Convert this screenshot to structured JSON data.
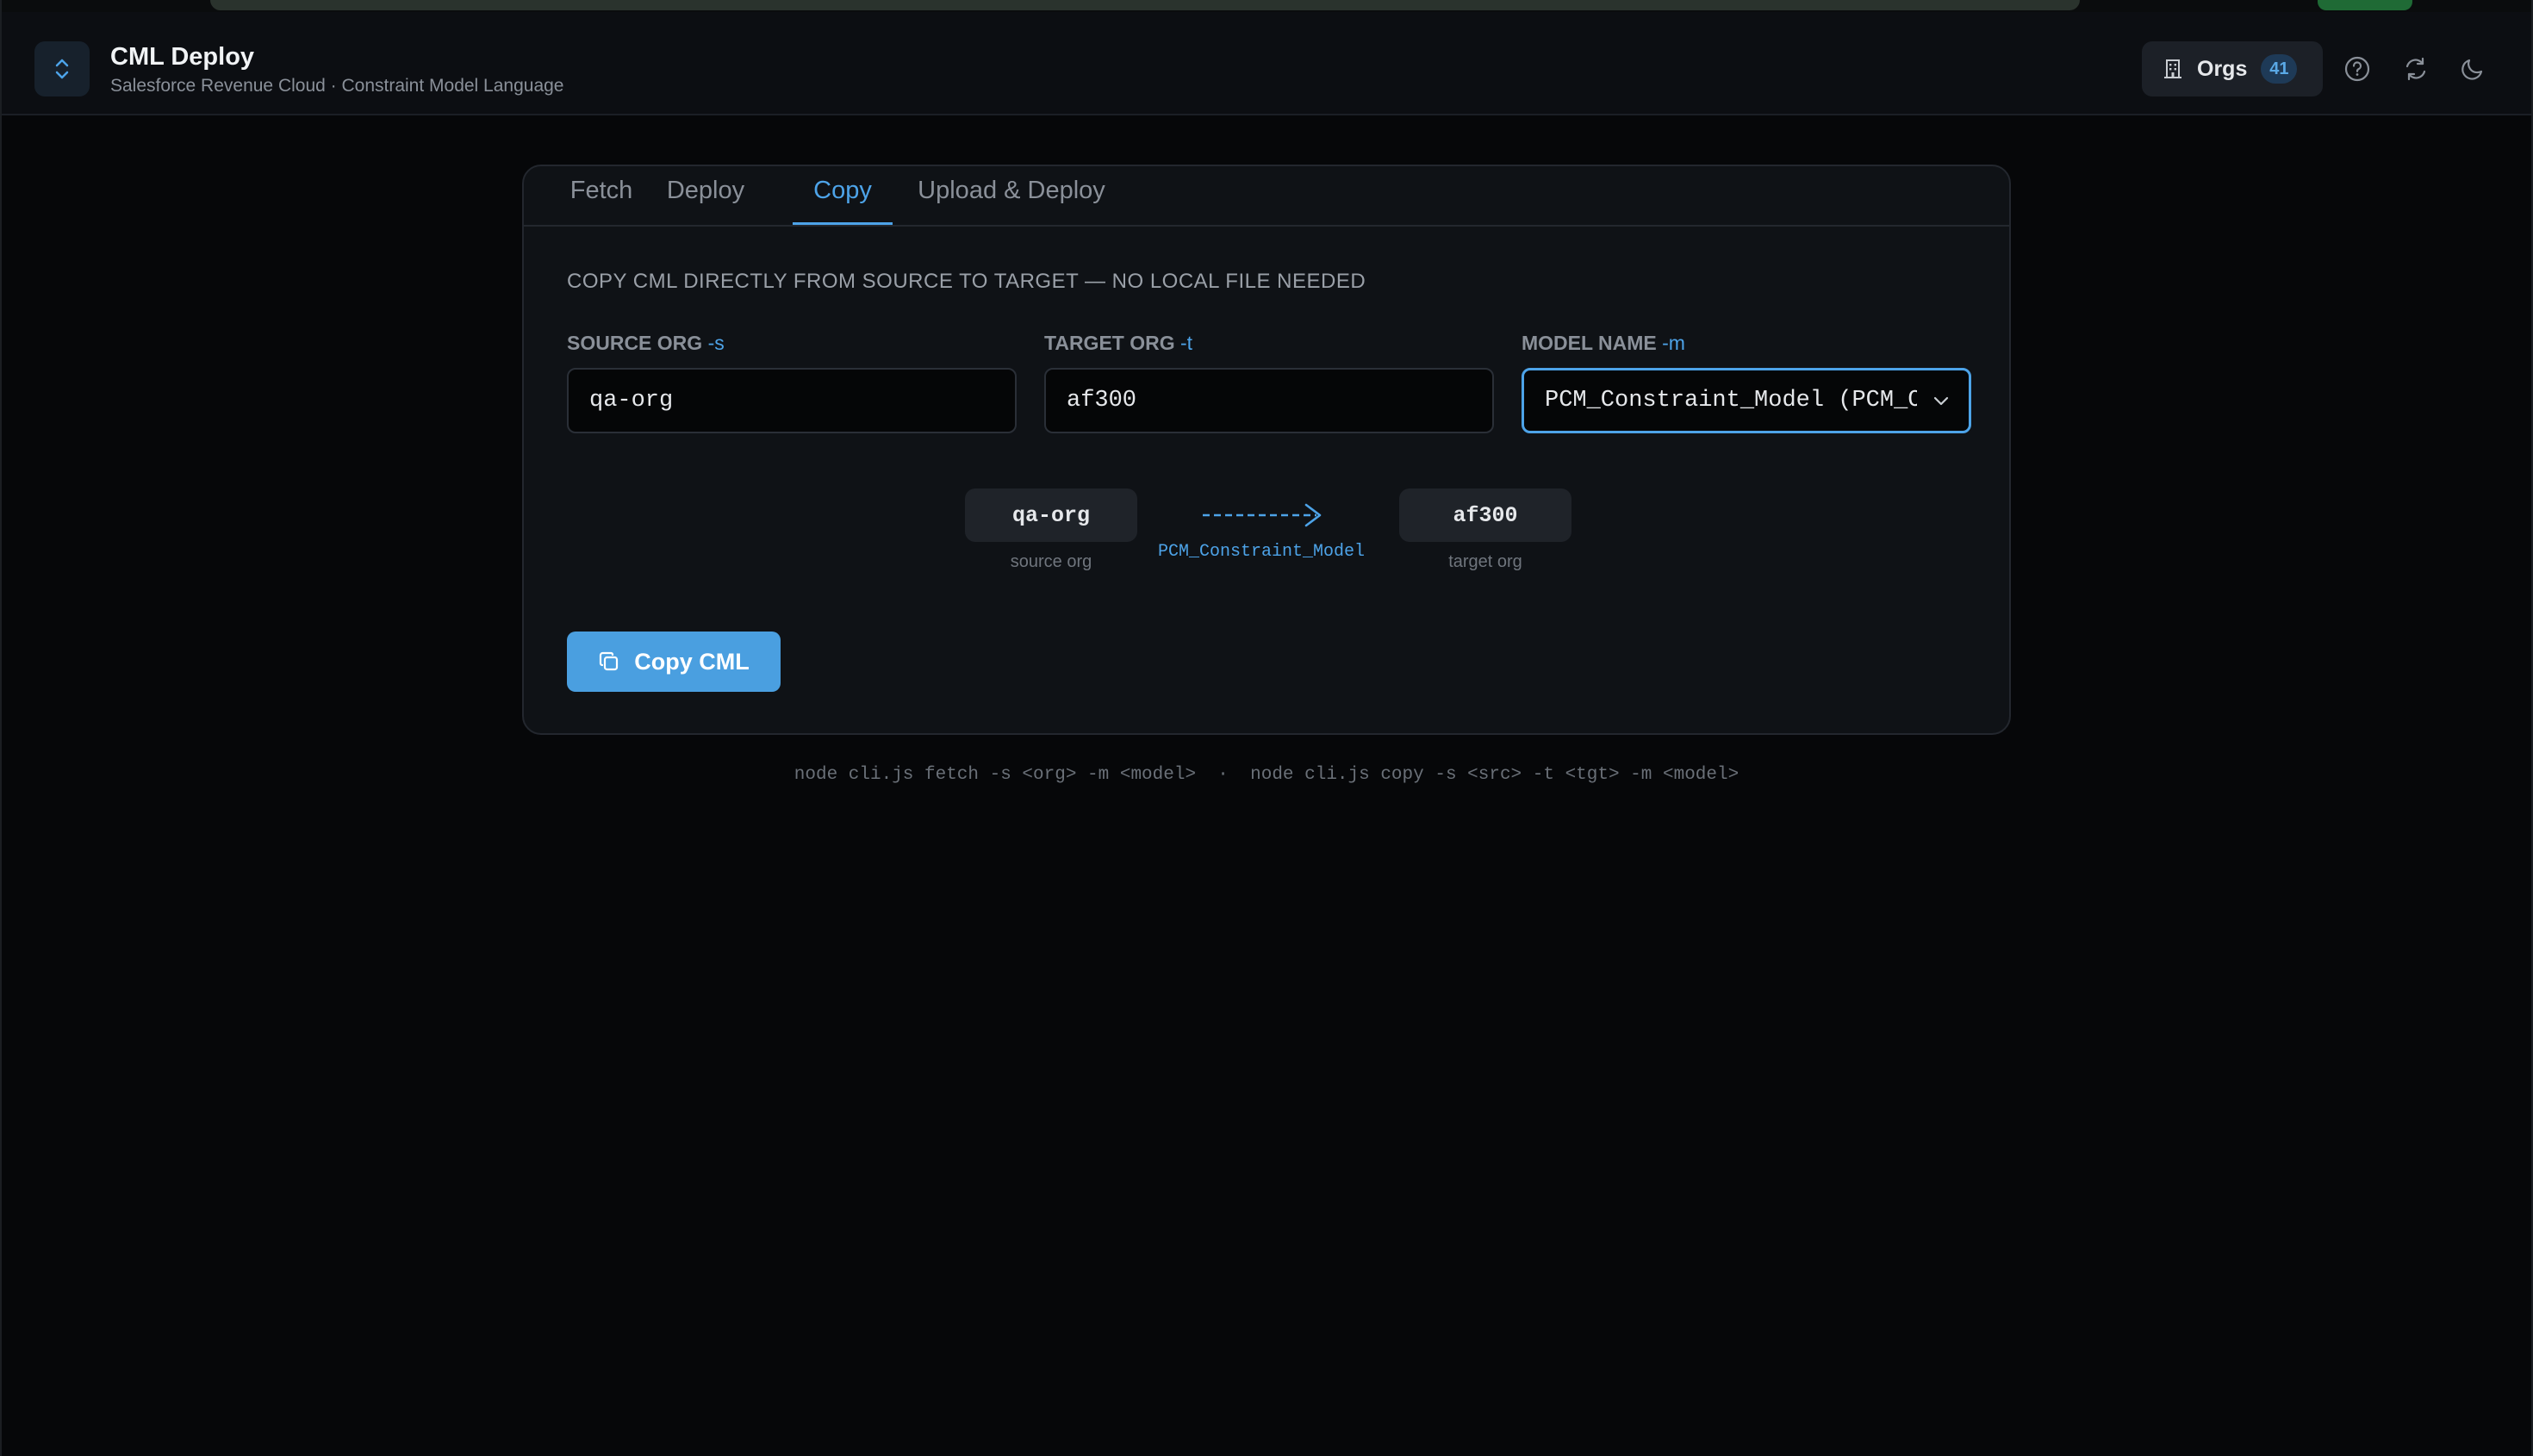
{
  "header": {
    "title": "CML Deploy",
    "subtitle": "Salesforce Revenue Cloud · Constraint Model Language",
    "orgs_label": "Orgs",
    "orgs_count": "41"
  },
  "tabs": [
    {
      "label": "Fetch",
      "active": false
    },
    {
      "label": "Deploy",
      "active": false
    },
    {
      "label": "Copy",
      "active": true
    },
    {
      "label": "Upload & Deploy",
      "active": false
    }
  ],
  "copy_panel": {
    "section_title": "COPY CML DIRECTLY FROM SOURCE TO TARGET — NO LOCAL FILE NEEDED",
    "source": {
      "label": "SOURCE ORG",
      "flag": "-s",
      "value": "qa-org"
    },
    "target": {
      "label": "TARGET ORG",
      "flag": "-t",
      "value": "af300"
    },
    "model": {
      "label": "MODEL NAME",
      "flag": "-m",
      "selected": "PCM_Constraint_Model (PCM_Constraint_Model)"
    },
    "flow": {
      "source_chip": "qa-org",
      "source_caption": "source org",
      "model_name": "PCM_Constraint_Model",
      "target_chip": "af300",
      "target_caption": "target org"
    },
    "button_label": "Copy CML"
  },
  "footer": {
    "cmd_fetch": "node cli.js fetch -s <org> -m <model>",
    "separator": "·",
    "cmd_copy": "node cli.js copy -s <src> -t <tgt> -m <model>"
  },
  "colors": {
    "accent": "#4da3e8",
    "background": "#060709",
    "card": "#0f1216"
  }
}
